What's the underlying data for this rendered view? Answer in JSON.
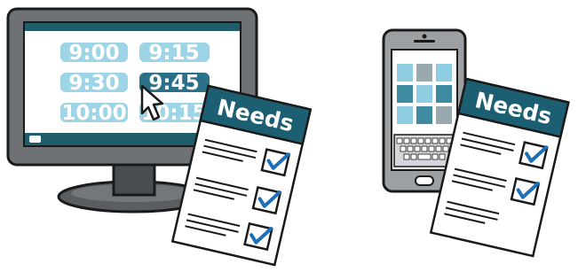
{
  "colors": {
    "outline": "#1a1a1a",
    "bezel": "#6f7275",
    "bezel_dark": "#3f4245",
    "stand": "#5b5e61",
    "screen_bg": "#ffffff",
    "screen_bar": "#1f5d6b",
    "slot_light": "#9ed5e6",
    "slot_selected": "#2a7088",
    "tile_dark": "#3e8aa0",
    "tile_light": "#8fcde2",
    "tile_grey": "#9aa9ad",
    "needs_header": "#1d5f72",
    "check": "#1d6fb8"
  },
  "desktop": {
    "time_slots": [
      {
        "label": "9:00",
        "selected": false
      },
      {
        "label": "9:15",
        "selected": false
      },
      {
        "label": "9:30",
        "selected": false
      },
      {
        "label": "9:45",
        "selected": true
      },
      {
        "label": "10:00",
        "selected": false
      },
      {
        "label": "10:15",
        "selected": false
      }
    ],
    "cursor_icon": "arrow-cursor-icon"
  },
  "documents": [
    {
      "title": "Needs",
      "checked_items": 3
    },
    {
      "title": "Needs",
      "checked_items": 2
    }
  ],
  "phone": {
    "tiles": [
      "tile_light",
      "tile_grey",
      "tile_light",
      "tile_dark",
      "tile_light",
      "tile_dark",
      "tile_light",
      "tile_dark",
      "tile_grey"
    ],
    "keyboard_icon": "keyboard-icon"
  }
}
